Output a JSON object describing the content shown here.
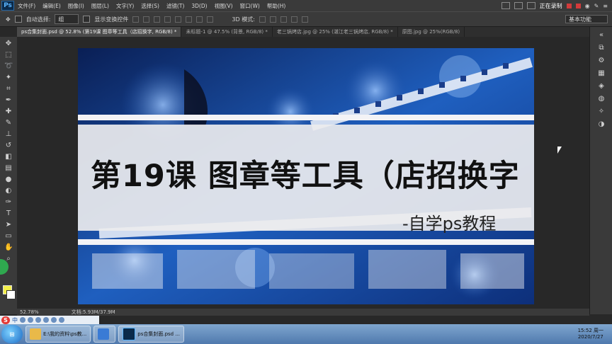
{
  "app": {
    "logo": "Ps"
  },
  "menu": [
    "文件(F)",
    "编辑(E)",
    "图像(I)",
    "图层(L)",
    "文字(Y)",
    "选择(S)",
    "滤镜(T)",
    "3D(D)",
    "视图(V)",
    "窗口(W)",
    "帮助(H)"
  ],
  "recording": {
    "label": "正在录制"
  },
  "options": {
    "auto_select_label": "自动选择:",
    "auto_select_value": "组",
    "show_transform_label": "显示变换控件",
    "mode_3d_label": "3D 模式:",
    "workspace": "基本功能"
  },
  "tabs": [
    {
      "label": "ps合集封面.psd @ 52.8% (第19课  图章等工具（店招换字, RGB/8) *",
      "active": true
    },
    {
      "label": "未标题-1 @ 47.5% (背景, RGB/8) *",
      "active": false
    },
    {
      "label": "老三锅烤店.jpg @ 25% (湛江老三锅烤店, RGB/8) *",
      "active": false
    },
    {
      "label": "原图.jpg @ 25%(RGB/8)",
      "active": false
    }
  ],
  "canvas": {
    "title": "第19课  图章等工具（店招换字",
    "subtitle": "-自学ps教程"
  },
  "status": {
    "zoom": "52.78%",
    "doc": "文档:5.93M/37.9M"
  },
  "taskbar": {
    "items": [
      {
        "label": "E:\\我的资料\\ps教...",
        "icon_color": "#e9b949"
      },
      {
        "label": "",
        "icon_color": "#3a7bd5"
      },
      {
        "label": "ps合集封面.psd ...",
        "icon_color": "#0b2a4a"
      }
    ],
    "time": "15:52 周一",
    "date": "2020/7/27"
  },
  "ime": {
    "label": "中"
  },
  "colors": {
    "foreground": "#f4f04a",
    "background": "#ffffff",
    "accent": "#5bb6ff"
  }
}
